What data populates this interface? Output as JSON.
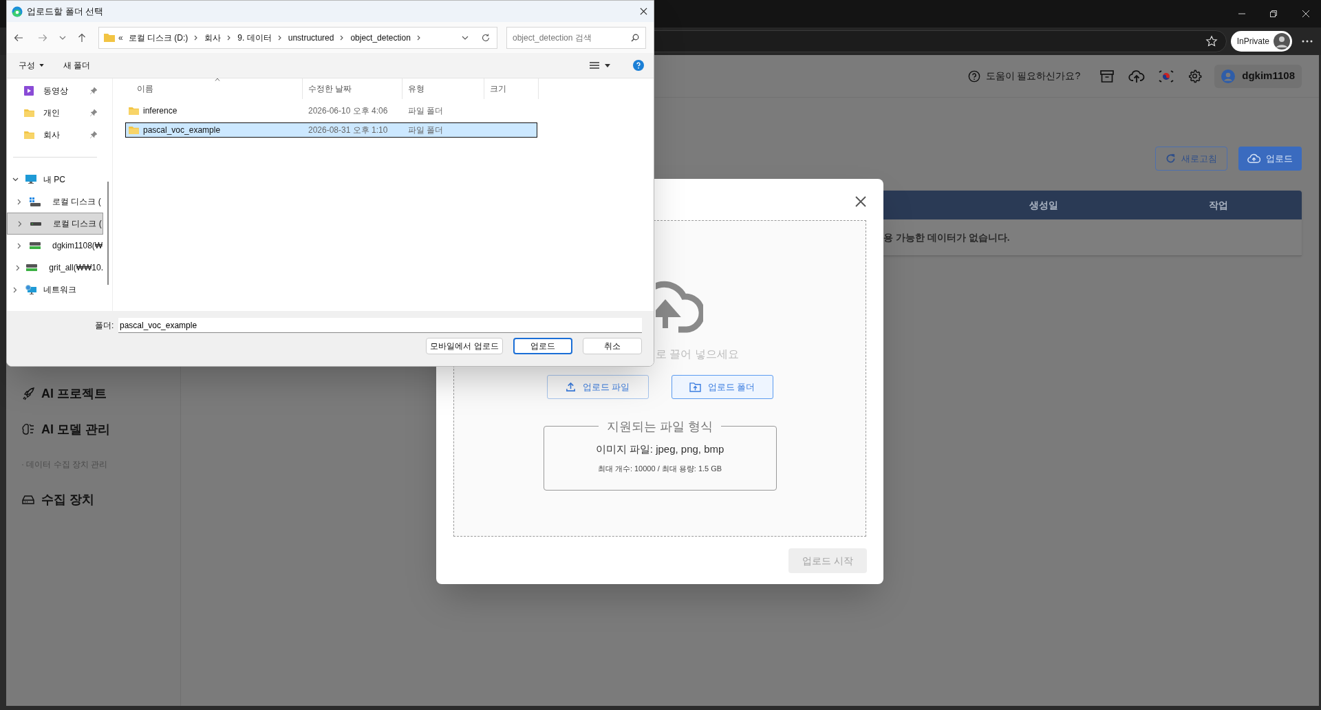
{
  "browser": {
    "inprivate_label": "InPrivate"
  },
  "page_header": {
    "help_text": "도움이 필요하신가요?",
    "username": "dgkim1108"
  },
  "sidebar": {
    "items": [
      {
        "kind": "rocket",
        "label": "AI 프로젝트"
      },
      {
        "kind": "model",
        "label": "AI 모델 관리"
      },
      {
        "kind": "section",
        "label": "· 데이터 수집 장치 관리"
      },
      {
        "kind": "device",
        "label": "수집 장치"
      }
    ]
  },
  "actions": [
    {
      "kind": "outline",
      "label": "새로고침"
    },
    {
      "kind": "primary",
      "label": "업로드"
    }
  ],
  "table": {
    "columns": [
      "생성일",
      "작업"
    ],
    "empty_message": "용 가능한 데이터가 없습니다."
  },
  "upload_modal": {
    "drop_hint": "로 끌어 넣으세요",
    "buttons": [
      {
        "kind": "file",
        "label": "업로드 파일",
        "selected": false
      },
      {
        "kind": "folder",
        "label": "업로드 폴더",
        "selected": true
      }
    ],
    "formats": {
      "legend": "지원되는 파일 형식",
      "line": "이미지 파일: jpeg, png, bmp",
      "limits": "최대 개수: 10000 / 최대 용량: 1.5 GB"
    },
    "start_button": {
      "label": "업로드 시작",
      "disabled": true
    }
  },
  "file_dialog": {
    "title": "업로드할 폴더 선택",
    "path_overflow": "«",
    "path": [
      "로컬 디스크 (D:)",
      "회사",
      "9. 데이터",
      "unstructured",
      "object_detection"
    ],
    "search_placeholder": "object_detection 검색",
    "commands": [
      {
        "kind": "menu",
        "label": "구성"
      },
      {
        "kind": "plain",
        "label": "새 폴더"
      }
    ],
    "quick_access": [
      {
        "kind": "video",
        "label": "동영상",
        "pinned": true
      },
      {
        "kind": "folder",
        "label": "개인",
        "pinned": true
      },
      {
        "kind": "folder",
        "label": "회사",
        "pinned": true
      }
    ],
    "tree": [
      {
        "kind": "pc",
        "label": "내 PC",
        "expanded": true,
        "selected": false,
        "children": [
          {
            "kind": "system-drive",
            "label": "로컬 디스크 (",
            "expanded": false,
            "selected": false
          },
          {
            "kind": "drive",
            "label": "로컬 디스크 (",
            "expanded": false,
            "selected": true
          },
          {
            "kind": "network-drive",
            "label": "dgkim1108(₩",
            "expanded": false,
            "selected": false
          },
          {
            "kind": "network-drive",
            "label": "grit_all(₩₩10.",
            "expanded": false,
            "selected": false
          }
        ]
      },
      {
        "kind": "network",
        "label": "네트워크",
        "expanded": false,
        "selected": false
      }
    ],
    "columns": [
      "이름",
      "수정한 날짜",
      "유형",
      "크기"
    ],
    "rows": [
      {
        "name": "inference",
        "modified": "2026-06-10 오후 4:06",
        "type": "파일 폴더",
        "selected": false
      },
      {
        "name": "pascal_voc_example",
        "modified": "2026-08-31 오후 1:10",
        "type": "파일 폴더",
        "selected": true
      }
    ],
    "folder_field": {
      "label": "폴더:",
      "value": "pascal_voc_example"
    },
    "buttons": [
      {
        "kind": "normal",
        "label": "모바일에서 업로드"
      },
      {
        "kind": "default",
        "label": "업로드"
      },
      {
        "kind": "normal",
        "label": "취소"
      }
    ]
  }
}
